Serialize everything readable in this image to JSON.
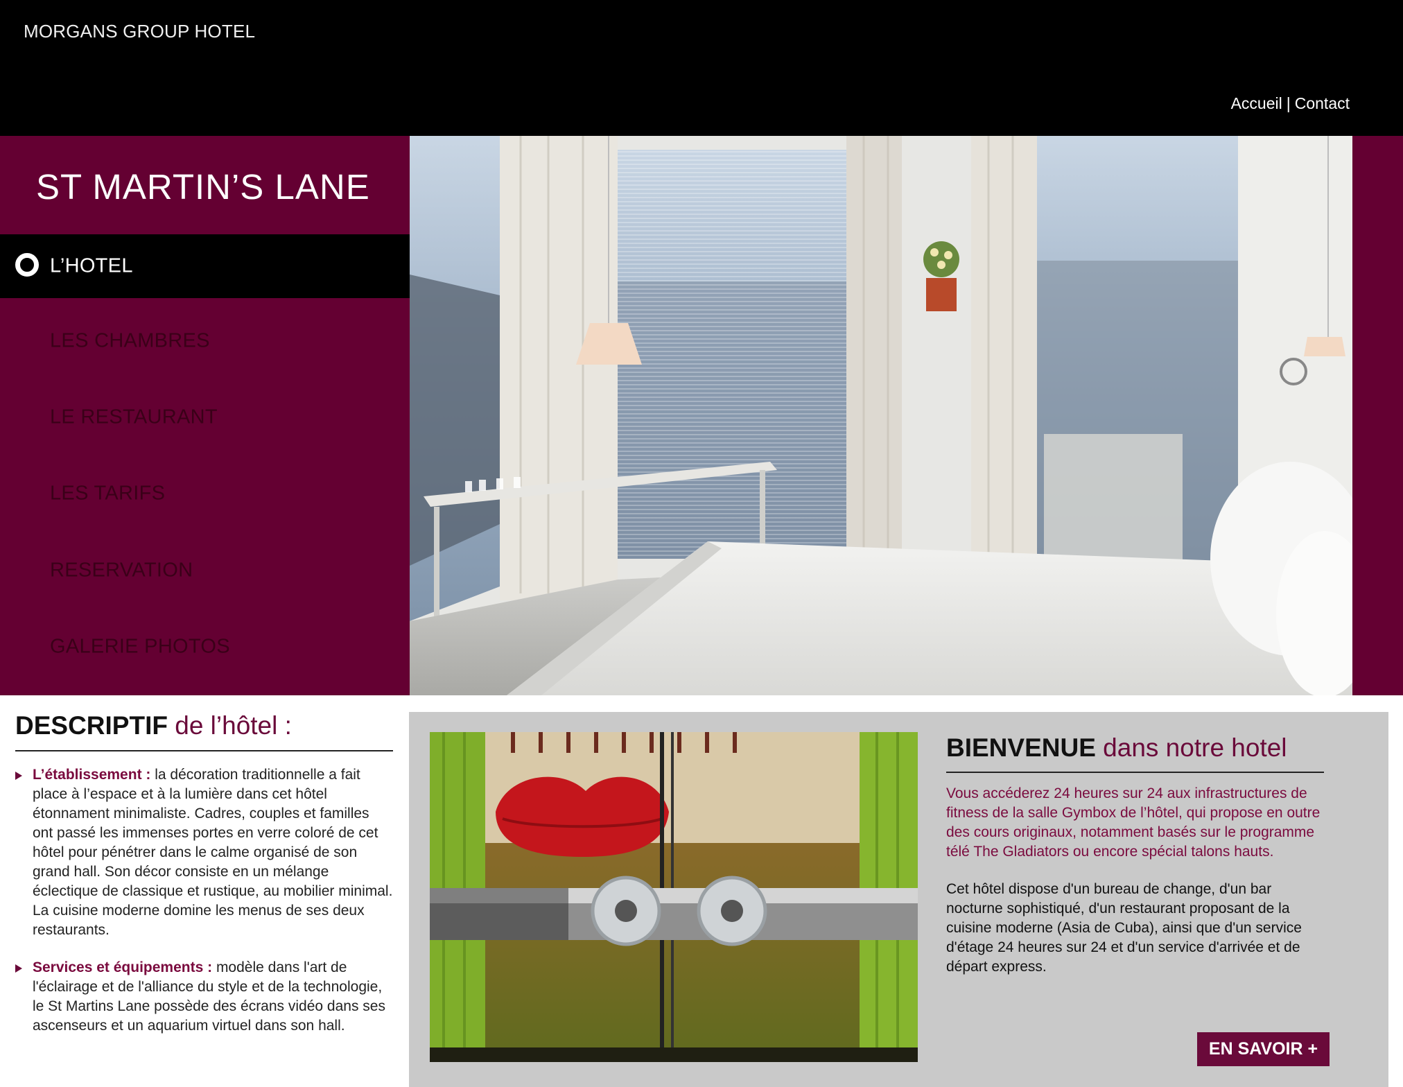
{
  "header": {
    "brand": "MORGANS GROUP HOTEL",
    "nav": [
      {
        "label": "Accueil"
      },
      {
        "label": "Contact"
      }
    ],
    "separator": "|"
  },
  "sidebar": {
    "title": "ST MARTIN’S LANE",
    "items": [
      {
        "label": "L’HOTEL",
        "active": true
      },
      {
        "label": "LES CHAMBRES"
      },
      {
        "label": "LE RESTAURANT"
      },
      {
        "label": "LES TARIFS"
      },
      {
        "label": "RESERVATION"
      },
      {
        "label": "GALERIE PHOTOS"
      }
    ]
  },
  "description": {
    "title_bold": "DESCRIPTIF",
    "title_rest": "de l’hôtel :",
    "paragraphs": [
      {
        "lead": "L’établissement :",
        "text": " la décoration traditionnelle a fait place à l’espace et à la lumière dans cet hôtel étonnament minimaliste. Cadres, couples et familles ont passé les immenses portes en verre coloré de cet hôtel pour pénétrer dans le calme organisé de son grand hall. Son décor consiste en un mélange éclectique de classique et rustique, au mobilier minimal. La cuisine moderne domine les menus de ses deux restaurants."
      },
      {
        "lead": "Services et équipements :",
        "text": " modèle dans l'art de l'éclairage et de l'alliance du style et de la technologie, le St Martins Lane possède des écrans vidéo dans ses ascenseurs et un aquarium virtuel dans son hall."
      }
    ]
  },
  "welcome": {
    "title_bold": "BIENVENUE",
    "title_rest": "dans notre hotel",
    "para1": "Vous accéderez 24 heures sur 24 aux infrastructures de fitness de la salle Gymbox de l’hôtel, qui propose en outre des cours originaux, notamment basés sur le programme télé The Gladiators ou encore spécial talons hauts.",
    "para2": "Cet hôtel dispose d'un bureau de change, d'un bar nocturne sophistiqué, d'un restaurant proposant de la cuisine moderne (Asia de Cuba), ainsi que d'un service d'étage 24 heures sur 24 et d'un service d'arrivée et de départ express.",
    "button": "EN SAVOIR +"
  },
  "colors": {
    "brand_plum": "#640032",
    "accent_text": "#7a0a3e",
    "header_bg": "#000000"
  }
}
